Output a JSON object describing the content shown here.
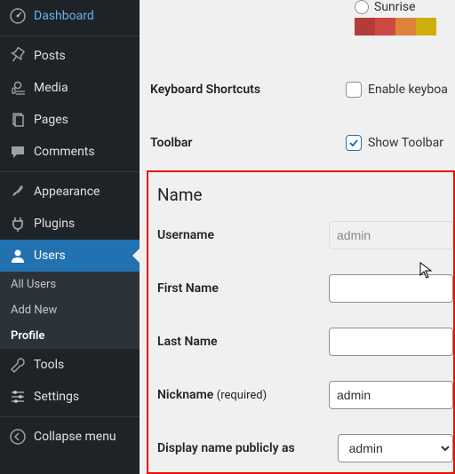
{
  "sidebar": {
    "items": [
      {
        "label": "Dashboard"
      },
      {
        "label": "Posts"
      },
      {
        "label": "Media"
      },
      {
        "label": "Pages"
      },
      {
        "label": "Comments"
      },
      {
        "label": "Appearance"
      },
      {
        "label": "Plugins"
      },
      {
        "label": "Users"
      },
      {
        "label": "Tools"
      },
      {
        "label": "Settings"
      },
      {
        "label": "Collapse menu"
      }
    ],
    "submenu": [
      {
        "label": "All Users"
      },
      {
        "label": "Add New"
      },
      {
        "label": "Profile"
      }
    ]
  },
  "scheme": {
    "name": "Sunrise",
    "swatches": [
      "#b43c38",
      "#cf4944",
      "#dd823b",
      "#ccaf0b"
    ]
  },
  "settings": {
    "kb_label": "Keyboard Shortcuts",
    "kb_option": "Enable keyboa",
    "tb_label": "Toolbar",
    "tb_option": "Show Toolbar "
  },
  "name_section": {
    "title": "Name",
    "username_label": "Username",
    "username_value": "admin",
    "first_label": "First Name",
    "first_value": "",
    "last_label": "Last Name",
    "last_value": "",
    "nick_label": "Nickname",
    "nick_req": "(required)",
    "nick_value": "admin",
    "display_label": "Display name publicly as",
    "display_value": "admin"
  }
}
